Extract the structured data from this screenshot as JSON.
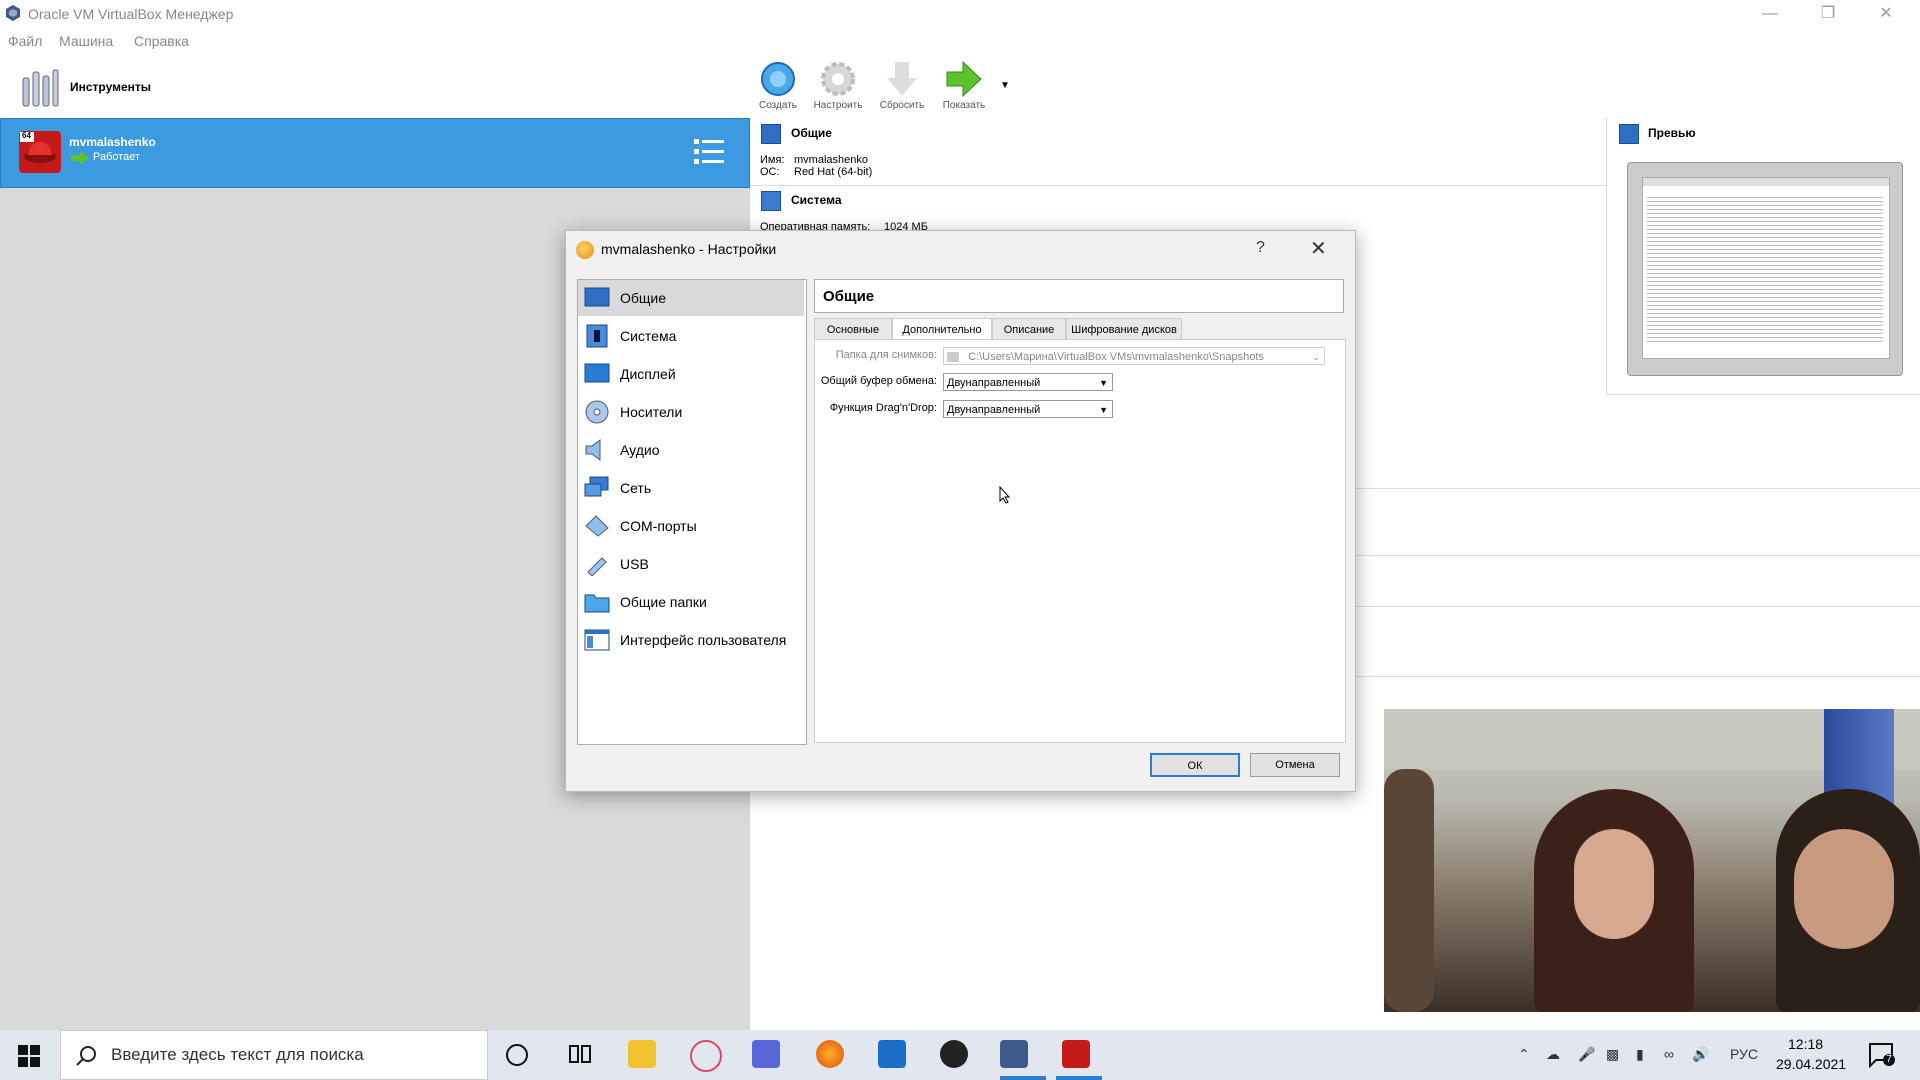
{
  "window": {
    "title": "Oracle VM VirtualBox Менеджер",
    "menu": [
      "Файл",
      "Машина",
      "Справка"
    ]
  },
  "left": {
    "tools_label": "Инструменты",
    "vm_name": "mvmalashenko",
    "vm_state": "Работает",
    "vm_badge": "64"
  },
  "toolbar": {
    "create": "Создать",
    "settings": "Настроить",
    "discard": "Сбросить",
    "show": "Показать"
  },
  "details": {
    "general_header": "Общие",
    "name_label": "Имя:",
    "name_value": "mvmalashenko",
    "os_label": "ОС:",
    "os_value": "Red Hat (64-bit)",
    "system_header": "Система",
    "ram_label": "Оперативная память:",
    "ram_value": "1024 МБ",
    "preview_header": "Превью"
  },
  "dialog": {
    "title": "mvmalashenko - Настройки",
    "help": "?",
    "nav": [
      {
        "label": "Общие"
      },
      {
        "label": "Система"
      },
      {
        "label": "Дисплей"
      },
      {
        "label": "Носители"
      },
      {
        "label": "Аудио"
      },
      {
        "label": "Сеть"
      },
      {
        "label": "COM-порты"
      },
      {
        "label": "USB"
      },
      {
        "label": "Общие папки"
      },
      {
        "label": "Интерфейс пользователя"
      }
    ],
    "page_title": "Общие",
    "tabs": [
      "Основные",
      "Дополнительно",
      "Описание",
      "Шифрование дисков"
    ],
    "snapshot_label": "Папка для снимков:",
    "snapshot_value": "C:\\Users\\Марина\\VirtualBox VMs\\mvmalashenko\\Snapshots",
    "clipboard_label": "Общий буфер обмена:",
    "clipboard_value": "Двунаправленный",
    "dnd_label": "Функция Drag'n'Drop:",
    "dnd_value": "Двунаправленный",
    "ok": "ОК",
    "cancel": "Отмена"
  },
  "taskbar": {
    "search_placeholder": "Введите здесь текст для поиска",
    "lang": "РУС",
    "time": "12:18",
    "date": "29.04.2021",
    "notifications": "7"
  }
}
